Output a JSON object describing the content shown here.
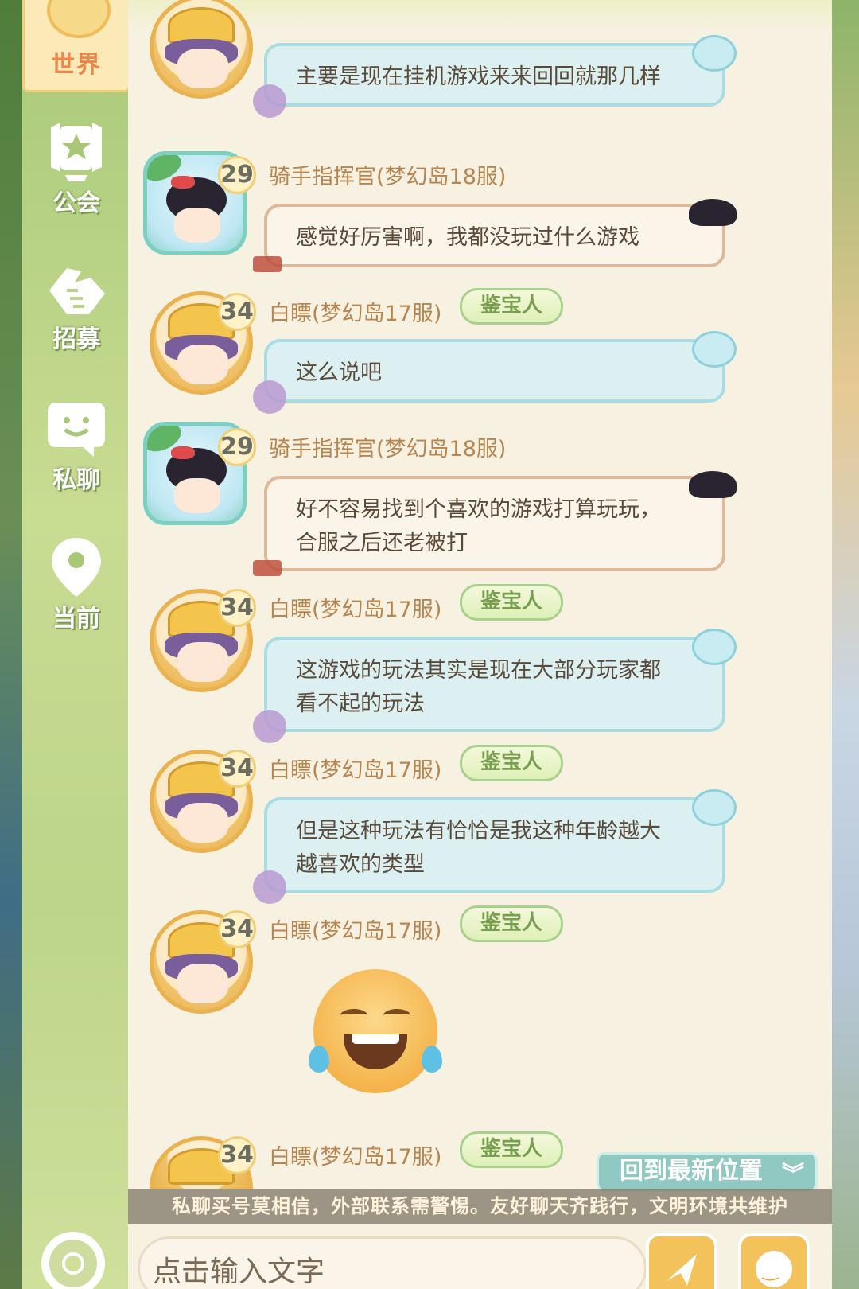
{
  "sidebar": {
    "tabs": [
      {
        "label": "世界",
        "icon": "globe-icon"
      },
      {
        "label": "公会",
        "icon": "guild-icon"
      },
      {
        "label": "招募",
        "icon": "handshake-icon"
      },
      {
        "label": "私聊",
        "icon": "chat-bubble-icon"
      },
      {
        "label": "当前",
        "icon": "location-pin-icon"
      }
    ],
    "settings_icon": "gear-icon"
  },
  "messages": [
    {
      "text": "主要是现在挂机游戏来来回回就那几样",
      "style": "blue"
    },
    {
      "level": "29",
      "name": "骑手指挥官(梦幻岛18服)",
      "text": "感觉好厉害啊，我都没玩过什么游戏",
      "style": "beige"
    },
    {
      "level": "34",
      "name": "白瞟(梦幻岛17服)",
      "badge": "鉴宝人",
      "text": "这么说吧",
      "style": "blue"
    },
    {
      "level": "29",
      "name": "骑手指挥官(梦幻岛18服)",
      "text_lines": [
        "好不容易找到个喜欢的游戏打算玩玩，",
        "合服之后还老被打"
      ],
      "style": "beige"
    },
    {
      "level": "34",
      "name": "白瞟(梦幻岛17服)",
      "badge": "鉴宝人",
      "text_lines": [
        "这游戏的玩法其实是现在大部分玩家都",
        "看不起的玩法"
      ],
      "style": "blue"
    },
    {
      "level": "34",
      "name": "白瞟(梦幻岛17服)",
      "badge": "鉴宝人",
      "text_lines": [
        "但是这种玩法有恰恰是我这种年龄越大",
        "越喜欢的类型"
      ],
      "style": "blue"
    },
    {
      "level": "34",
      "name": "白瞟(梦幻岛17服)",
      "badge": "鉴宝人",
      "sticker": "laughing-crying-emoji"
    },
    {
      "level": "34",
      "name": "白瞟(梦幻岛17服)",
      "badge": "鉴宝人"
    }
  ],
  "jump_button": "回到最新位置",
  "notice": "私聊买号莫相信，外部联系需警惕。友好聊天齐践行，文明环境共维护",
  "input": {
    "placeholder": "点击输入文字"
  },
  "colors": {
    "name": "#b9854f",
    "badge": "#7a9e4f",
    "accent": "#f3c25a",
    "blue_bubble": "#dcf0f2",
    "beige_bubble": "#fbf4e9"
  }
}
